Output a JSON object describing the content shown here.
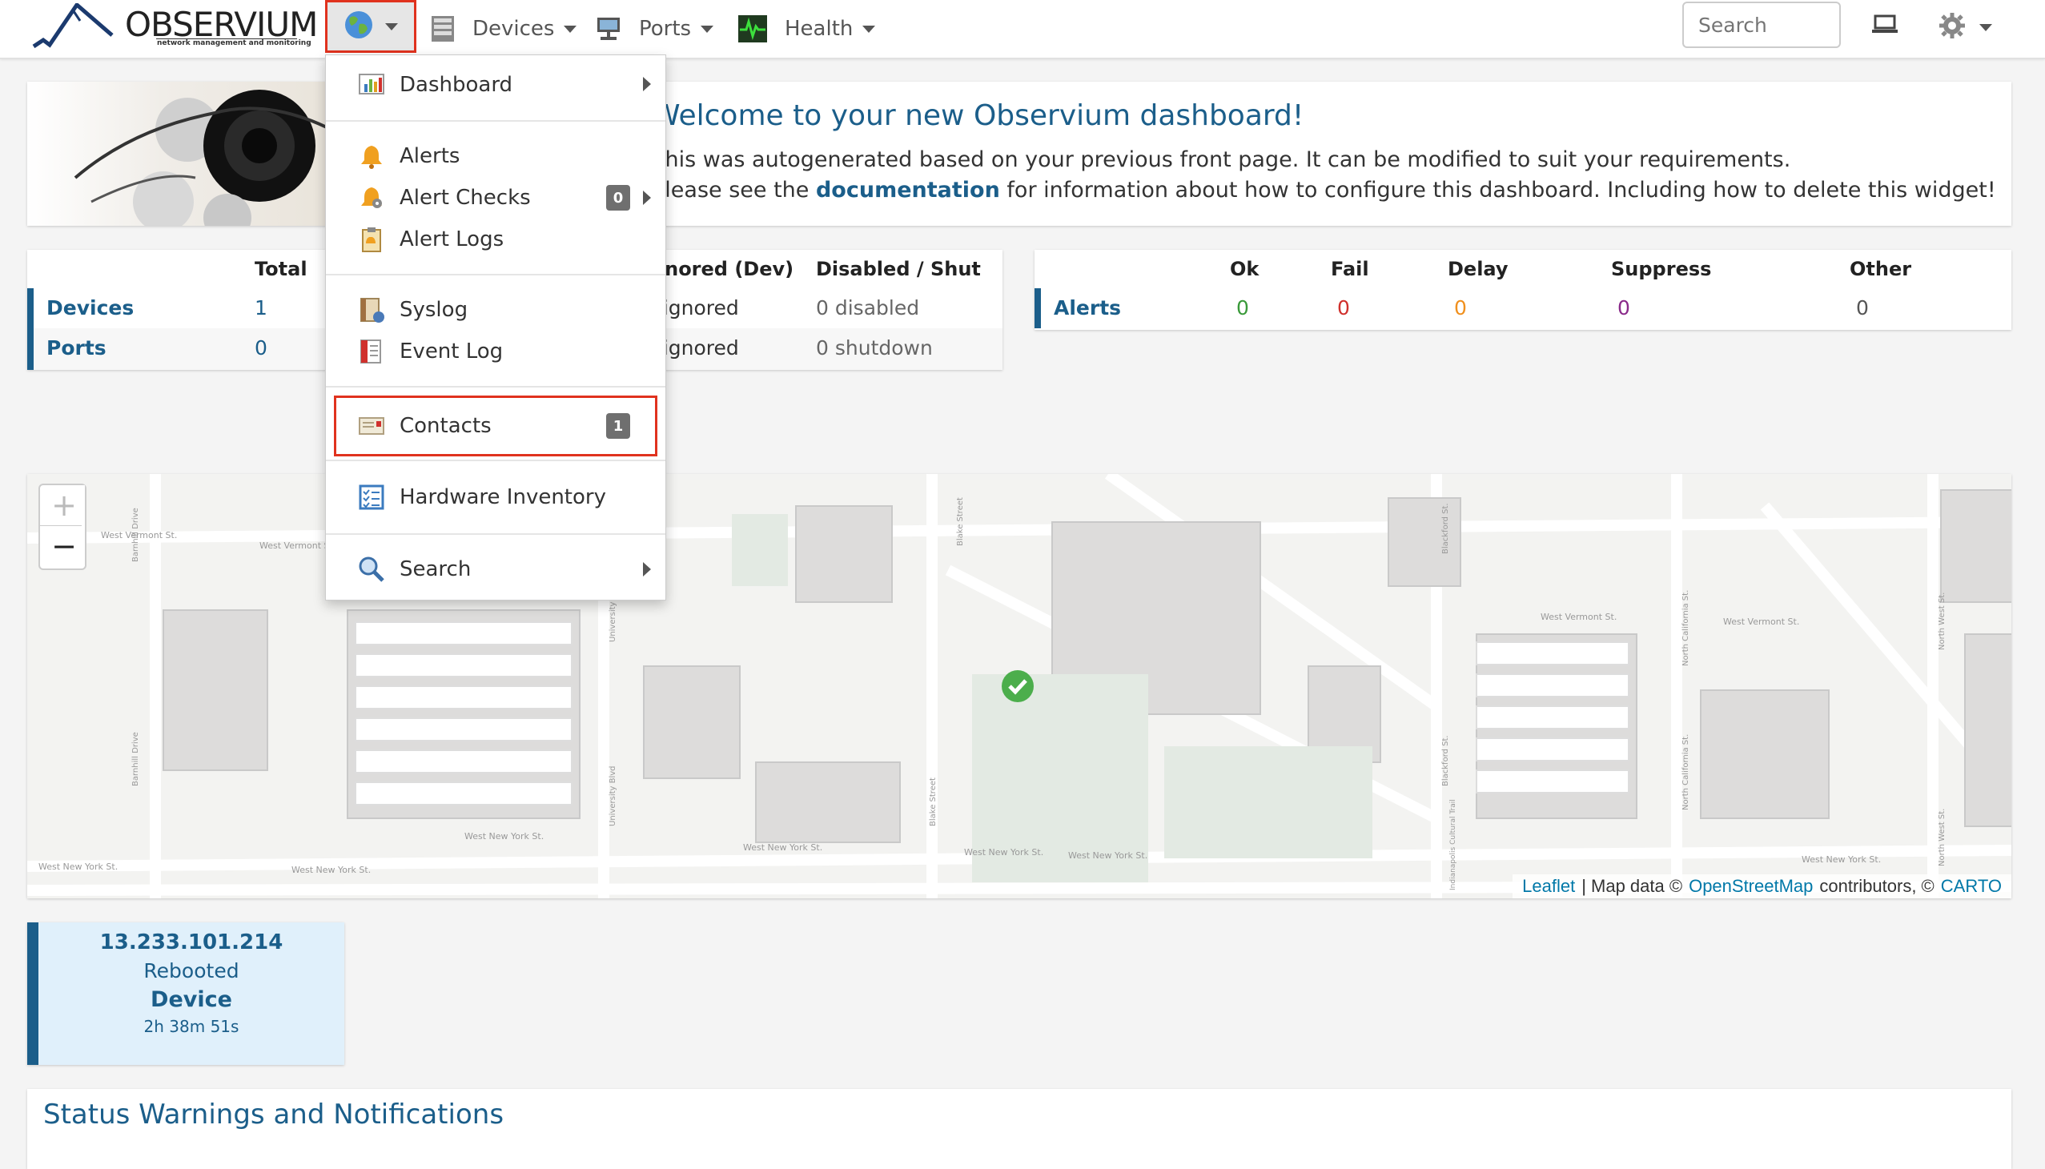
{
  "app": {
    "logo_text": "OBSERVIUM",
    "logo_sub": "network management and monitoring"
  },
  "navbar": {
    "globe_icon": "globe-icon",
    "items": [
      {
        "label": "Devices",
        "icon": "server-icon"
      },
      {
        "label": "Ports",
        "icon": "network-port-icon"
      },
      {
        "label": "Health",
        "icon": "heartbeat-icon"
      }
    ],
    "search_placeholder": "Search"
  },
  "menu": {
    "items": [
      {
        "label": "Dashboard",
        "icon": "chart-icon"
      },
      {
        "label": "Alerts",
        "icon": "bell-icon"
      },
      {
        "label": "Alert Checks",
        "icon": "bell-gear-icon",
        "badge": "0"
      },
      {
        "label": "Alert Logs",
        "icon": "clipboard-icon"
      },
      {
        "label": "Syslog",
        "icon": "syslog-icon"
      },
      {
        "label": "Event Log",
        "icon": "event-log-icon"
      },
      {
        "label": "Contacts",
        "icon": "contact-card-icon",
        "badge": "1"
      },
      {
        "label": "Hardware Inventory",
        "icon": "checklist-icon"
      },
      {
        "label": "Search",
        "icon": "magnifier-icon"
      }
    ]
  },
  "welcome": {
    "title": "Welcome to your new Observium dashboard!",
    "line1": "This was autogenerated based on your previous front page. It can be modified to suit your requirements.",
    "line2_prefix": "Please see the",
    "line2_link": "documentation",
    "line2_suffix": "for information about how to configure this dashboard. Including how to delete this widget!"
  },
  "status_table": {
    "headers": [
      "Total",
      "Ignored (Dev)",
      "Disabled / Shut"
    ],
    "rows": [
      {
        "label": "Devices",
        "total": "1",
        "ignored": "0 ignored",
        "disabled": "0 disabled"
      },
      {
        "label": "Ports",
        "total": "0",
        "ignored": "0 ignored",
        "disabled": "0 shutdown"
      }
    ]
  },
  "alerts_table": {
    "headers": [
      "Ok",
      "Fail",
      "Delay",
      "Suppress",
      "Other"
    ],
    "row_label": "Alerts",
    "values": [
      "0",
      "0",
      "0",
      "0",
      "0"
    ],
    "colors": [
      "#3a9a3a",
      "#d0312d",
      "#f0901e",
      "#8a2a8a",
      "#555555"
    ]
  },
  "map": {
    "zoom_in": "+",
    "zoom_out": "−",
    "attribution_link1": "Leaflet",
    "attribution_mid": "| Map data ©",
    "attribution_link2": "OpenStreetMap",
    "attribution_mid2": "contributors, ©",
    "attribution_link3": "CARTO",
    "street_labels": [
      "West Vermont St.",
      "West Vermont St.",
      "West Vermont St.",
      "Barnhill Drive",
      "Barnhill Drive",
      "University Blvd",
      "University Blvd",
      "Blake Street",
      "Blake Street",
      "Blackford St.",
      "Blackford St.",
      "North California St.",
      "North California St.",
      "North West St.",
      "North West St.",
      "West New York St.",
      "West New York St.",
      "West New York St.",
      "West New York St.",
      "West New York St.",
      "West New York St.",
      "Indianapolis Cultural Trail",
      "West New York St.",
      "West Vermont St."
    ]
  },
  "device_card": {
    "ip": "13.233.101.214",
    "status": "Rebooted",
    "type": "Device",
    "uptime": "2h 38m 51s"
  },
  "status_warnings": {
    "title": "Status Warnings and Notifications"
  }
}
